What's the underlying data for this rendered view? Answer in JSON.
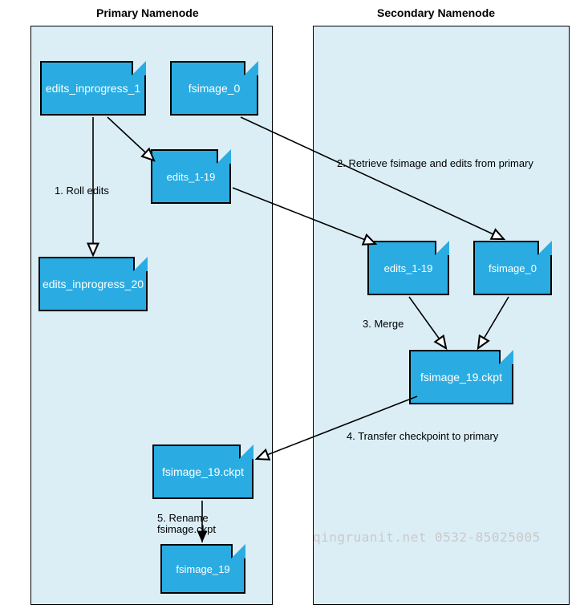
{
  "headers": {
    "primary": "Primary Namenode",
    "secondary": "Secondary Namenode"
  },
  "files": {
    "edits_inprogress_1": "edits_inprogress_1",
    "fsimage_0_primary": "fsimage_0",
    "edits_1_19_primary": "edits_1-19",
    "edits_inprogress_20": "edits_inprogress_20",
    "edits_1_19_secondary": "edits_1-19",
    "fsimage_0_secondary": "fsimage_0",
    "fsimage_19_ckpt_secondary": "fsimage_19.ckpt",
    "fsimage_19_ckpt_primary": "fsimage_19.ckpt",
    "fsimage_19": "fsimage_19"
  },
  "steps": {
    "s1": "1. Roll edits",
    "s2": "2. Retrieve fsimage and edits from primary",
    "s3": "3. Merge",
    "s4": "4. Transfer checkpoint to primary",
    "s5a": "5. Rename",
    "s5b": "fsimage.ckpt"
  },
  "watermark": "qingruanit.net 0532-85025005",
  "chart_data": {
    "type": "diagram",
    "nodes": [
      {
        "id": "edits_inprogress_1",
        "label": "edits_inprogress_1",
        "owner": "primary"
      },
      {
        "id": "fsimage_0_primary",
        "label": "fsimage_0",
        "owner": "primary"
      },
      {
        "id": "edits_1_19_primary",
        "label": "edits_1-19",
        "owner": "primary"
      },
      {
        "id": "edits_inprogress_20",
        "label": "edits_inprogress_20",
        "owner": "primary"
      },
      {
        "id": "edits_1_19_secondary",
        "label": "edits_1-19",
        "owner": "secondary"
      },
      {
        "id": "fsimage_0_secondary",
        "label": "fsimage_0",
        "owner": "secondary"
      },
      {
        "id": "fsimage_19_ckpt_secondary",
        "label": "fsimage_19.ckpt",
        "owner": "secondary"
      },
      {
        "id": "fsimage_19_ckpt_primary",
        "label": "fsimage_19.ckpt",
        "owner": "primary"
      },
      {
        "id": "fsimage_19",
        "label": "fsimage_19",
        "owner": "primary"
      }
    ],
    "edges": [
      {
        "from": "edits_inprogress_1",
        "to": "edits_1_19_primary",
        "label": "1. Roll edits",
        "head": "open"
      },
      {
        "from": "edits_inprogress_1",
        "to": "edits_inprogress_20",
        "label": "1. Roll edits",
        "head": "open"
      },
      {
        "from": "fsimage_0_primary",
        "to": "fsimage_0_secondary",
        "label": "2. Retrieve fsimage and edits from primary",
        "head": "open"
      },
      {
        "from": "edits_1_19_primary",
        "to": "edits_1_19_secondary",
        "label": "2. Retrieve fsimage and edits from primary",
        "head": "open"
      },
      {
        "from": "edits_1_19_secondary",
        "to": "fsimage_19_ckpt_secondary",
        "label": "3. Merge",
        "head": "open"
      },
      {
        "from": "fsimage_0_secondary",
        "to": "fsimage_19_ckpt_secondary",
        "label": "3. Merge",
        "head": "open"
      },
      {
        "from": "fsimage_19_ckpt_secondary",
        "to": "fsimage_19_ckpt_primary",
        "label": "4. Transfer checkpoint to primary",
        "head": "open"
      },
      {
        "from": "fsimage_19_ckpt_primary",
        "to": "fsimage_19",
        "label": "5. Rename fsimage.ckpt",
        "head": "solid"
      }
    ]
  }
}
